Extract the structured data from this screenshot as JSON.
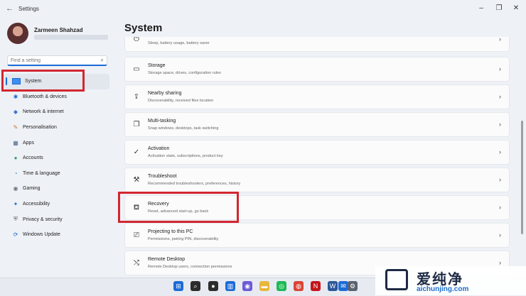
{
  "window": {
    "title": "Settings",
    "back": "←",
    "minimize": "–",
    "maximize": "❐",
    "close": "✕"
  },
  "profile": {
    "name": "Zarmeen Shahzad"
  },
  "search": {
    "placeholder": "Find a setting",
    "icon": "⌕"
  },
  "nav": {
    "items": [
      {
        "label": "System",
        "icon": "system-icon",
        "glyph": "",
        "active": true
      },
      {
        "label": "Bluetooth & devices",
        "icon": "bluetooth-icon",
        "glyph": "✱"
      },
      {
        "label": "Network & internet",
        "icon": "wifi-icon",
        "glyph": "◆"
      },
      {
        "label": "Personalisation",
        "icon": "brush-icon",
        "glyph": "✎"
      },
      {
        "label": "Apps",
        "icon": "apps-icon",
        "glyph": "▦"
      },
      {
        "label": "Accounts",
        "icon": "person-icon",
        "glyph": "●"
      },
      {
        "label": "Time & language",
        "icon": "globe-icon",
        "glyph": "◔"
      },
      {
        "label": "Gaming",
        "icon": "controller-icon",
        "glyph": "◉"
      },
      {
        "label": "Accessibility",
        "icon": "accessibility-icon",
        "glyph": "✦"
      },
      {
        "label": "Privacy & security",
        "icon": "shield-icon",
        "glyph": "⛨"
      },
      {
        "label": "Windows Update",
        "icon": "update-icon",
        "glyph": "⟳"
      }
    ]
  },
  "page": {
    "heading": "System"
  },
  "cards": [
    {
      "title": "",
      "subtitle": "Sleep, battery usage, battery saver",
      "icon": "power-icon",
      "glyph": "⏻"
    },
    {
      "title": "Storage",
      "subtitle": "Storage space, drives, configuration rules",
      "icon": "storage-icon",
      "glyph": "▭"
    },
    {
      "title": "Nearby sharing",
      "subtitle": "Discoverability, received files location",
      "icon": "share-icon",
      "glyph": "⇪"
    },
    {
      "title": "Multi-tasking",
      "subtitle": "Snap windows, desktops, task switching",
      "icon": "multitask-icon",
      "glyph": "❐"
    },
    {
      "title": "Activation",
      "subtitle": "Activation state, subscriptions, product key",
      "icon": "check-circle-icon",
      "glyph": "✓"
    },
    {
      "title": "Troubleshoot",
      "subtitle": "Recommended troubleshooters, preferences, history",
      "icon": "wrench-icon",
      "glyph": "⚒"
    },
    {
      "title": "Recovery",
      "subtitle": "Reset, advanced start-up, go back",
      "icon": "recovery-icon",
      "glyph": "⛾"
    },
    {
      "title": "Projecting to this PC",
      "subtitle": "Permissions, pairing PIN, discoverability",
      "icon": "project-icon",
      "glyph": "⎚"
    },
    {
      "title": "Remote Desktop",
      "subtitle": "Remote Desktop users, connection permissions",
      "icon": "remote-icon",
      "glyph": "⤭"
    }
  ],
  "chevron": "›",
  "taskbar": {
    "items": [
      {
        "icon": "start-icon",
        "glyph": "⊞",
        "color": "#1c6bd6"
      },
      {
        "icon": "search-icon",
        "glyph": "⌕",
        "color": "#2b2b2b"
      },
      {
        "icon": "camera-icon",
        "glyph": "●",
        "color": "#2b2b2b"
      },
      {
        "icon": "widgets-icon",
        "glyph": "▥",
        "color": "#1c6bd6"
      },
      {
        "icon": "chat-icon",
        "glyph": "◉",
        "color": "#6b5bd6"
      },
      {
        "icon": "folder-icon",
        "glyph": "▬",
        "color": "#e8b63a"
      },
      {
        "icon": "spotify-icon",
        "glyph": "◎",
        "color": "#1db954"
      },
      {
        "icon": "chrome-icon",
        "glyph": "◍",
        "color": "#db4437"
      },
      {
        "icon": "netflix-icon",
        "glyph": "N",
        "color": "#c4141c"
      },
      {
        "icon": "word-icon",
        "glyph": "W",
        "color": "#2b5797"
      },
      {
        "icon": "mail-icon",
        "glyph": "✉",
        "color": "#1c6bd6"
      },
      {
        "icon": "settings-icon",
        "glyph": "⚙",
        "color": "#5a6270"
      }
    ]
  },
  "watermark": {
    "name": "爱纯净",
    "url": "aichunjing.com"
  }
}
